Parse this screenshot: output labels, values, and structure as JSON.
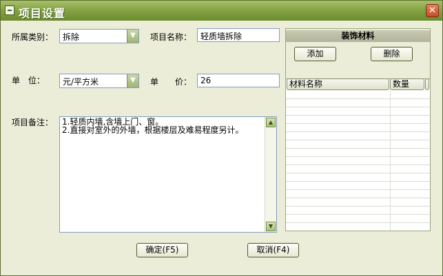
{
  "window": {
    "title": "项目设置",
    "close_symbol": "✕"
  },
  "form": {
    "category_label": "所属类别：",
    "category_value": "拆除",
    "name_label": "项目名称：",
    "name_value": "轻质墙拆除",
    "unit_label": "单　位：",
    "unit_value": "元/平方米",
    "price_label": "单　　价：",
    "price_value": "26",
    "note_label": "项目备注：",
    "note_lines": [
      "1.轻质内墙,含墙上门、窗。",
      "2.直接对室外的外墙，根据楼层及难易程度另计。"
    ]
  },
  "materials_panel": {
    "title": "装饰材料",
    "add_label": "添加",
    "delete_label": "删除",
    "columns": [
      "材料名称",
      "数量"
    ],
    "rows": []
  },
  "buttons": {
    "ok_label": "确定(F5)",
    "cancel_label": "取消(F4)"
  }
}
